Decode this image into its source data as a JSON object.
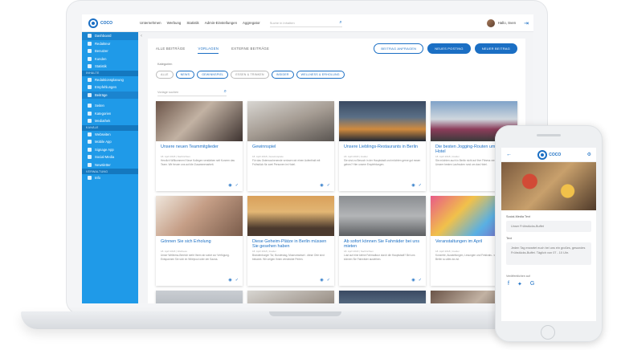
{
  "app": {
    "logo": "COCO"
  },
  "topnav": [
    "Unternehmen",
    "Werbung",
    "Statistik",
    "Admin-Einstellungen",
    "Aggregator"
  ],
  "search": {
    "placeholder": "Suche in Inhalten"
  },
  "user": {
    "name": "Hallo, Sven"
  },
  "sidebar": {
    "group1": [
      "Dashboard",
      "Redakteur",
      "Benutzer",
      "Kunden",
      "Statistik"
    ],
    "head_inhalte": "INHALTE",
    "group2": [
      "Redaktionsplanung",
      "Empfehlungen",
      "Beiträge"
    ],
    "group3": [
      "Seiten",
      "Kategorien",
      "Mediathek"
    ],
    "head_kanale": "KANÄLE",
    "group4": [
      "Webseiten",
      "Mobile App",
      "Signage App",
      "Social-Media",
      "Newsletter"
    ],
    "head_verwaltung": "VERWALTUNG",
    "group5": [
      "Info"
    ]
  },
  "tabs": [
    "ALLE BEITRÄGE",
    "VORLAGEN",
    "EXTERNE BEITRÄGE"
  ],
  "buttons": {
    "request": "BEITRAG ANFRAGEN",
    "new_posting": "NEUES POSTING",
    "new_post": "NEUER BEITRAG"
  },
  "categories": {
    "label": "Kategorien",
    "chips": [
      "ALLE",
      "NEWS",
      "GEWINNSPIEL",
      "ESSEN & TRINKEN",
      "INSIDER",
      "WELLNESS & ERHOLUNG"
    ]
  },
  "card_search": {
    "placeholder": "Vorlage suchen"
  },
  "cards": [
    {
      "title": "Unsere neuen Teammitglieder",
      "date": "18. April 2018 | Nachrichten",
      "text": "Herzlich Willkommen! Neue Kollegen verstärken seit Kurzem das Team. Wir freuen uns auf die Zusammenarbeit."
    },
    {
      "title": "Gewinnspiel",
      "date": "18. April 2018 | Gewinnspiele",
      "text": "Für das Osterwochenende verlosen wir einen Aufenthalt mit Frühstück für zwei Personen im Hotel."
    },
    {
      "title": "Unsere Lieblings-Restaurants in Berlin",
      "date": "18. April 2018 | Insider",
      "text": "Sie sind zu Besuch in der Hauptstadt und möchten gerne gut essen gehen? Hier unsere Empfehlungen."
    },
    {
      "title": "Die besten Jogging-Routen um unser Hotel",
      "date": "18. April 2018 | Insider",
      "text": "Sie möchten auch in Berlin nicht auf Ihre Fitness verzichten? Unsere besten Laufrouten rund um das Hotel."
    },
    {
      "title": "Gönnen Sie sich Erholung",
      "date": "18. April 2018 | Wellness",
      "text": "Unser Wellness-Bereich steht Ihnen ab sofort zur Verfügung. Entspannen Sie sich im Whirlpool oder der Sauna."
    },
    {
      "title": "Diese Geheim-Plätze in Berlin müssen Sie gesehen haben",
      "date": "18. April 2018 | Insider",
      "text": "Brandenburger Tor, Bundestag, Museumsinsel - diese Orte sind bekannt. Wir zeigen Ihnen versteckte Perlen."
    },
    {
      "title": "Ab sofort können Sie Fahrräder bei uns mieten",
      "date": "18. April 2018 | Nachrichten",
      "text": "Lust auf eine kleine Fahrradtour durch die Hauptstadt? Bei uns können Sie Fahrräder ausleihen."
    },
    {
      "title": "Veranstaltungen im April",
      "date": "18. April 2018 | Insider",
      "text": "Konzerte, Ausstellungen, Lesungen und Festivals - was im April in Berlin so alles los ist."
    }
  ],
  "phone": {
    "logo": "COCO",
    "field1_label": "Social-Media Text",
    "field1_value": "Unser Frühstücks-Buffet",
    "field2_label": "Text",
    "field2_value": "Jeden Tag erwartet euch bei uns ein großes, gesundes Frühstücks-Buffet. Täglich von 07 - 10 Uhr.",
    "publish_label": "Veröffentlichen auf"
  }
}
